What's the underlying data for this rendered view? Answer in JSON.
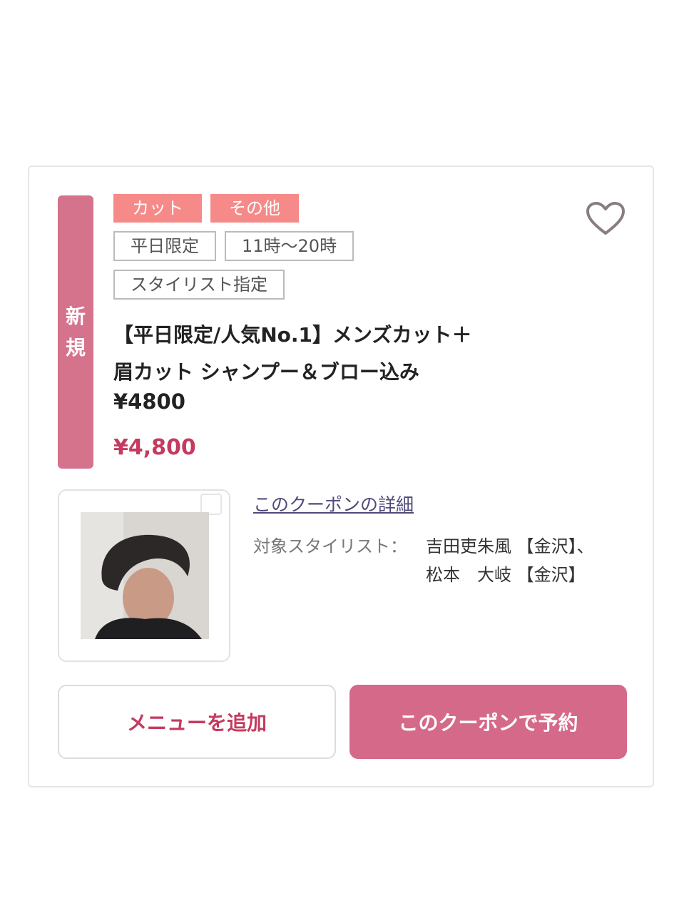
{
  "card": {
    "new_badge_line1": "新",
    "new_badge_line2": "規",
    "favorite_icon": "heart-outline-icon",
    "tags_category": [
      "カット",
      "その他"
    ],
    "tags_conditions": [
      "平日限定",
      "11時〜20時"
    ],
    "tags_stylist": [
      "スタイリスト指定"
    ],
    "title_line1": "【平日限定/人気No.1】メンズカット＋",
    "title_line2": "眉カット シャンプー＆ブロー込み",
    "price_in_title": "¥4800",
    "price": "¥4,800",
    "detail_link": "このクーポンの詳細",
    "stylist_label": "対象スタイリスト：",
    "stylist_line1": "吉田吏朱風 【金沢】、",
    "stylist_line2": "松本　大岐 【金沢】",
    "add_menu_button": "メニューを追加",
    "reserve_button": "このクーポンで予約"
  },
  "colors": {
    "accent_pink": "#d5698a",
    "tag_pink": "#f58a89",
    "price_red": "#c43b5f"
  }
}
